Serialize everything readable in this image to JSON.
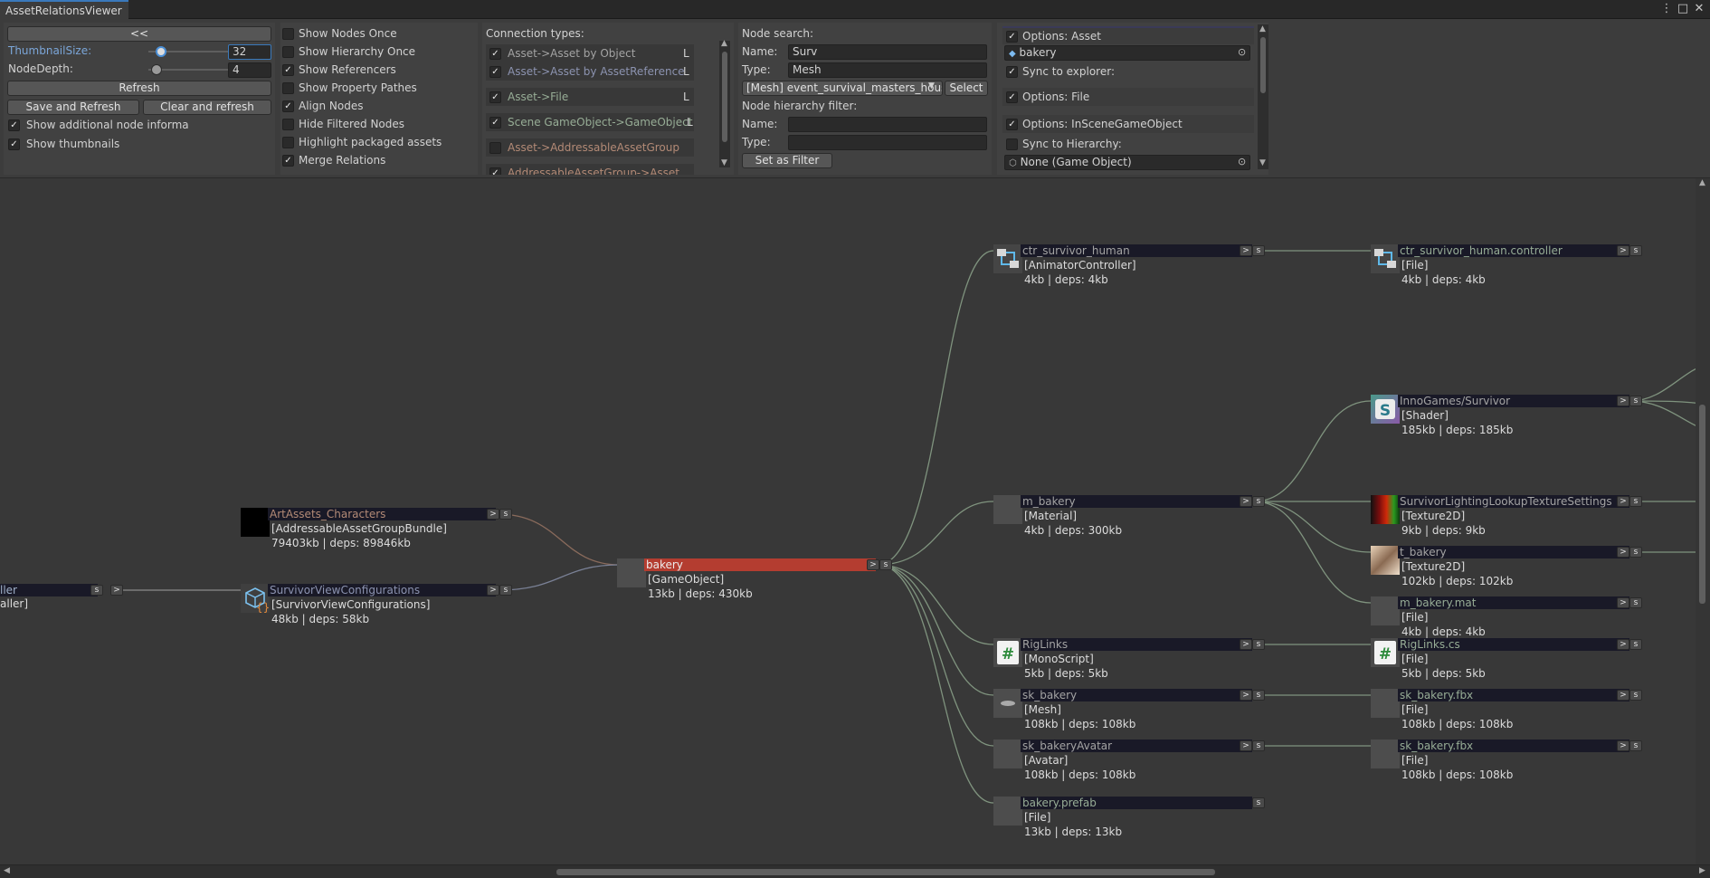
{
  "window": {
    "tab_title": "AssetRelationsViewer",
    "controls": [
      "⋮",
      "□",
      "✕"
    ]
  },
  "settings": {
    "collapse_label": "<<",
    "thumbnail_size_label": "ThumbnailSize:",
    "thumbnail_size_value": "32",
    "node_depth_label": "NodeDepth:",
    "node_depth_value": "4",
    "refresh_label": "Refresh",
    "save_refresh_label": "Save and Refresh",
    "clear_refresh_label": "Clear and refresh",
    "show_additional_label": "Show additional node informa",
    "show_thumbnails_label": "Show thumbnails"
  },
  "display_options": [
    {
      "label": "Show Nodes Once",
      "checked": false
    },
    {
      "label": "Show Hierarchy Once",
      "checked": false
    },
    {
      "label": "Show Referencers",
      "checked": true
    },
    {
      "label": "Show Property Pathes",
      "checked": false
    },
    {
      "label": "Align Nodes",
      "checked": true
    },
    {
      "label": "Hide Filtered Nodes",
      "checked": false
    },
    {
      "label": "Highlight packaged assets",
      "checked": false
    },
    {
      "label": "Merge Relations",
      "checked": true
    }
  ],
  "connections": {
    "title": "Connection types:",
    "items": [
      {
        "label": "Asset->Asset by Object",
        "checked": true,
        "color": "#a3a3a3",
        "flag": "L"
      },
      {
        "label": "Asset->Asset by AssetReference",
        "checked": true,
        "color": "#8c93b0",
        "flag": "L"
      },
      {
        "label": "Asset->File",
        "checked": true,
        "color": "#97ad96",
        "flag": "L"
      },
      {
        "label": "Scene GameObject->GameObject",
        "checked": true,
        "color": "#97ad96",
        "flag": "L"
      },
      {
        "label": "Asset->AddressableAssetGroup",
        "checked": false,
        "color": "#b38a76",
        "flag": ""
      },
      {
        "label": "AddressableAssetGroup->Asset",
        "checked": true,
        "color": "#b38a76",
        "flag": "L"
      }
    ]
  },
  "search": {
    "title": "Node search:",
    "name_label": "Name:",
    "name_value": "Surv",
    "type_label": "Type:",
    "type_value": "Mesh",
    "result_value": "[Mesh] event_survival_masters_hous",
    "select_label": "Select",
    "hierarchy_title": "Node hierarchy filter:",
    "h_name_label": "Name:",
    "h_type_label": "Type:",
    "filter_label": "Set as Filter"
  },
  "options": {
    "asset_label": "Options: Asset",
    "asset_object": "bakery",
    "sync_explorer_label": "Sync to explorer:",
    "file_label": "Options: File",
    "inscene_label": "Options: InSceneGameObject",
    "sync_hierarchy_label": "Sync to Hierarchy:",
    "none_object": "None (Game Object)"
  },
  "nodes": [
    {
      "id": "n_ctl_left",
      "name": "ller",
      "type": "aller]",
      "size": "",
      "color": "#9fb0c9"
    },
    {
      "id": "n_artassets",
      "name": "ArtAssets_Characters",
      "type": "[AddressableAssetGroupBundle]",
      "size": "79403kb | deps: 89846kb",
      "color": "#b38a76"
    },
    {
      "id": "n_svc",
      "name": "SurvivorViewConfigurations",
      "type": "[SurvivorViewConfigurations]",
      "size": "48kb | deps: 58kb",
      "color": "#8c93b0"
    },
    {
      "id": "n_bakery",
      "name": "bakery",
      "type": "[GameObject]",
      "size": "13kb | deps: 430kb",
      "color": "#e6e6e6"
    },
    {
      "id": "n_ctr",
      "name": "ctr_survivor_human",
      "type": "[AnimatorController]",
      "size": "4kb | deps: 4kb",
      "color": "#a3a3a3"
    },
    {
      "id": "n_mbakery",
      "name": "m_bakery",
      "type": "[Material]",
      "size": "4kb | deps: 300kb",
      "color": "#a3a3a3"
    },
    {
      "id": "n_riglinks",
      "name": "RigLinks",
      "type": "[MonoScript]",
      "size": "5kb | deps: 5kb",
      "color": "#a3a3a3"
    },
    {
      "id": "n_skbakery",
      "name": "sk_bakery",
      "type": "[Mesh]",
      "size": "108kb | deps: 108kb",
      "color": "#a3a3a3"
    },
    {
      "id": "n_skavatar",
      "name": "sk_bakeryAvatar",
      "type": "[Avatar]",
      "size": "108kb | deps: 108kb",
      "color": "#a3a3a3"
    },
    {
      "id": "n_prefab",
      "name": "bakery.prefab",
      "type": "[File]",
      "size": "13kb | deps: 13kb",
      "color": "#97ad96"
    },
    {
      "id": "n_ctrfile",
      "name": "ctr_survivor_human.controller",
      "type": "[File]",
      "size": "4kb | deps: 4kb",
      "color": "#97ad96"
    },
    {
      "id": "n_shader",
      "name": "InnoGames/Survivor",
      "type": "[Shader]",
      "size": "185kb | deps: 185kb",
      "color": "#a3a3a3"
    },
    {
      "id": "n_lut",
      "name": "SurvivorLightingLookupTextureSettings",
      "type": "[Texture2D]",
      "size": "9kb | deps: 9kb",
      "color": "#a3a3a3"
    },
    {
      "id": "n_tbakery",
      "name": "t_bakery",
      "type": "[Texture2D]",
      "size": "102kb | deps: 102kb",
      "color": "#a3a3a3"
    },
    {
      "id": "n_mat",
      "name": "m_bakery.mat",
      "type": "[File]",
      "size": "4kb | deps: 4kb",
      "color": "#97ad96"
    },
    {
      "id": "n_rigcs",
      "name": "RigLinks.cs",
      "type": "[File]",
      "size": "5kb | deps: 5kb",
      "color": "#97ad96"
    },
    {
      "id": "n_fbx1",
      "name": "sk_bakery.fbx",
      "type": "[File]",
      "size": "108kb | deps: 108kb",
      "color": "#97ad96"
    },
    {
      "id": "n_fbx2",
      "name": "sk_bakery.fbx",
      "type": "[File]",
      "size": "108kb | deps: 108kb",
      "color": "#97ad96"
    }
  ],
  "node_buttons": {
    "s": "s",
    "go": ">"
  }
}
